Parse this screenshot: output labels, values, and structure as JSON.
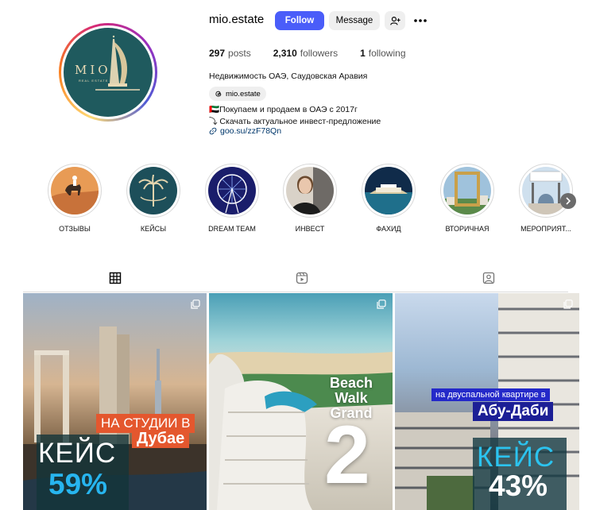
{
  "profile": {
    "username": "mio.estate",
    "avatar_brand": "MIO",
    "avatar_brand_sub": "REAL ESTATE",
    "follow_label": "Follow",
    "message_label": "Message",
    "stats": {
      "posts_count": "297",
      "posts_label": "posts",
      "followers_count": "2,310",
      "followers_label": "followers",
      "following_count": "1",
      "following_label": "following"
    },
    "bio_title": "Недвижимость ОАЭ, Саудовская Аравия",
    "threads_handle": "mio.estate",
    "bio_line1": "🇦🇪Покупаем и продаем в ОАЭ с 2017г",
    "bio_line2": "⤵ Скачать актуальное инвест-предложение",
    "link": "goo.su/zzF78Qn"
  },
  "highlights": [
    {
      "label": "ОТЗЫВЫ"
    },
    {
      "label": "КЕЙСЫ"
    },
    {
      "label": "DREAM TEAM"
    },
    {
      "label": "ИНВЕСТ"
    },
    {
      "label": "ФАХИД"
    },
    {
      "label": "ВТОРИЧНАЯ"
    },
    {
      "label": "МЕРОПРИЯТ..."
    }
  ],
  "tabs": {
    "active": "posts",
    "icons": [
      "grid-icon",
      "reels-icon",
      "tagged-icon"
    ]
  },
  "posts": [
    {
      "tag": "НА СТУДИИ В",
      "city": "Дубае",
      "headline": "КЕЙС",
      "percent": "59%"
    },
    {
      "title_line1": "Beach",
      "title_line2": "Walk",
      "title_line3": "Grand",
      "number": "2"
    },
    {
      "tag": "на двуспальной квартире в",
      "city": "Абу-Даби",
      "headline": "КЕЙС",
      "percent": "43%"
    }
  ],
  "colors": {
    "follow_button": "#4a5df9",
    "link": "#00376b",
    "accent_orange": "#e4572e",
    "accent_blue": "#27b5ef"
  }
}
